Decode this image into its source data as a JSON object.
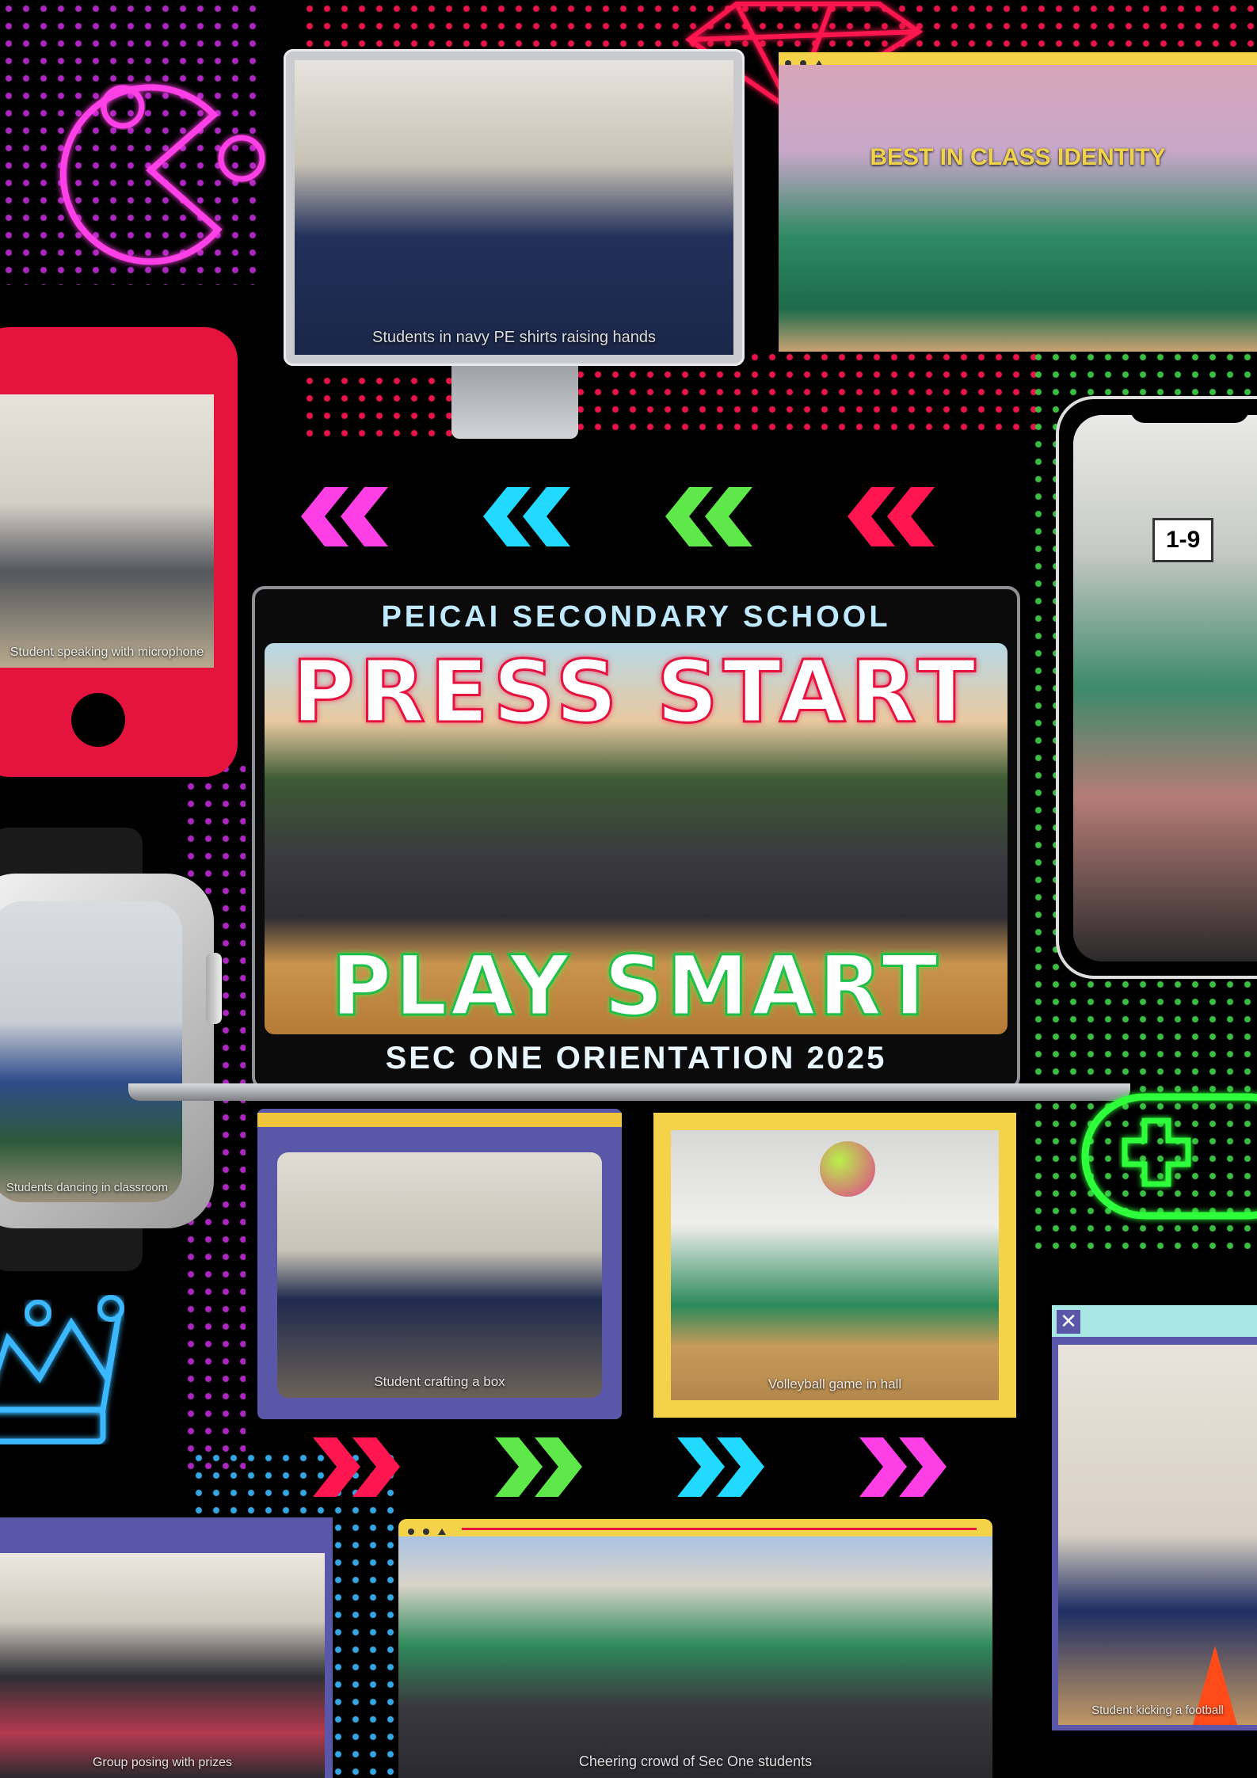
{
  "header": {
    "school": "PEICAI SECONDARY SCHOOL",
    "headline": "PRESS START",
    "tagline": "PLAY SMART",
    "event": "SEC ONE ORIENTATION 2025"
  },
  "photos": {
    "top_monitor": "Students in navy PE shirts raising hands",
    "top_window": "BEST IN CLASS IDENTITY",
    "left_phone": "Student speaking with microphone",
    "right_phone": "1-9",
    "left_watch": "Students dancing in classroom",
    "mid_left_window": "Student crafting a box",
    "mid_right_window": "Volleyball game in hall",
    "bottom_right_window": "Student kicking a football",
    "bottom_left_window": "Group posing with prizes",
    "bottom_center_window": "Cheering crowd of Sec One students"
  },
  "colors": {
    "magenta": "#ff3fe6",
    "cyan": "#22d9ff",
    "green": "#5fe84a",
    "red": "#ff1650",
    "navy_window": "#5a57a8",
    "yellow_window": "#f4d24a",
    "neon_green": "#2dff3a",
    "neon_blue": "#3ab8ff"
  },
  "icons": [
    "pacman-icon",
    "gem-icon",
    "crown-icon",
    "gamepad-icon",
    "close-icon"
  ]
}
